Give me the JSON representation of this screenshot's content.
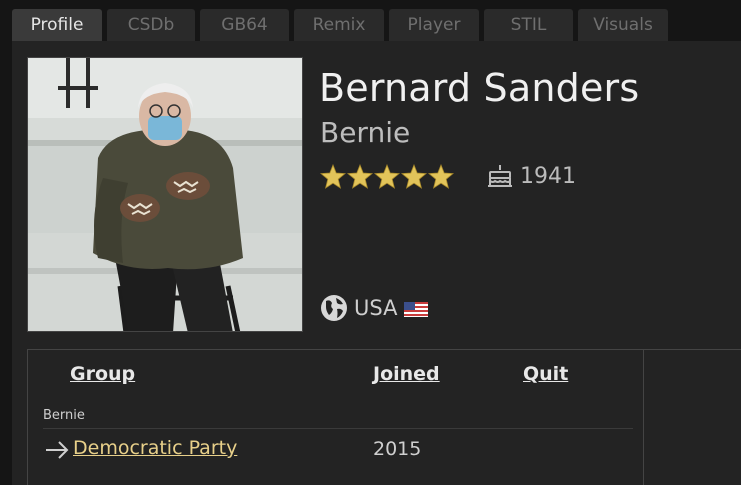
{
  "tabs": [
    {
      "label": "Profile",
      "active": true
    },
    {
      "label": "CSDb",
      "active": false
    },
    {
      "label": "GB64",
      "active": false
    },
    {
      "label": "Remix",
      "active": false
    },
    {
      "label": "Player",
      "active": false
    },
    {
      "label": "STIL",
      "active": false
    },
    {
      "label": "Visuals",
      "active": false
    }
  ],
  "profile": {
    "name": "Bernard Sanders",
    "handle": "Bernie",
    "rating_stars": 5,
    "birth_year": "1941",
    "country": "USA",
    "icons": {
      "cake": "cake-icon",
      "globe": "globe-icon",
      "flag": "us-flag-icon",
      "star": "star-icon"
    }
  },
  "groups_table": {
    "headers": {
      "group": "Group",
      "joined": "Joined",
      "quit": "Quit"
    },
    "handle_label": "Bernie",
    "rows": [
      {
        "group": "Democratic Party",
        "joined": "2015",
        "quit": ""
      }
    ]
  },
  "colors": {
    "link": "#e8d08a",
    "star": "#e2c45a",
    "background": "#232323"
  }
}
